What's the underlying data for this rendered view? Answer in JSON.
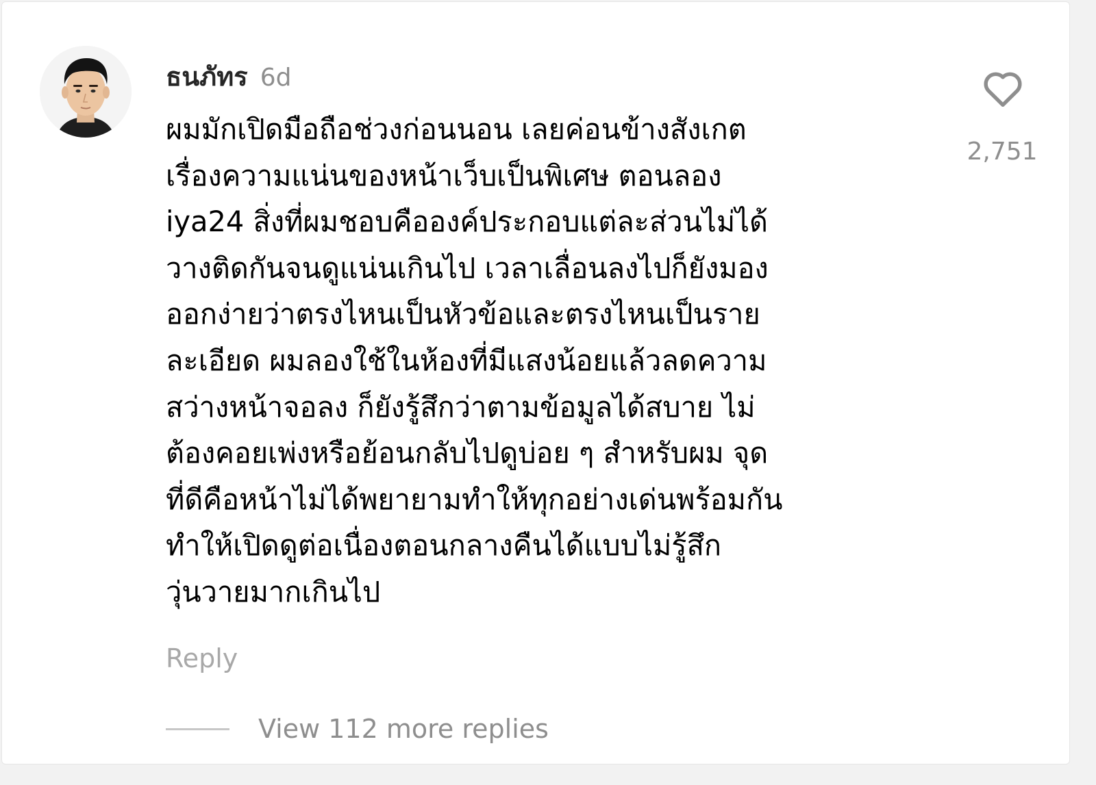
{
  "comment": {
    "username": "ธนภัทร",
    "time_ago": "6d",
    "text": "ผมมักเปิดมือถือช่วงก่อนนอน เลยค่อนข้างสังเกต\nเรื่องความแน่นของหน้าเว็บเป็นพิเศษ ตอนลอง\niya24 สิ่งที่ผมชอบคือองค์ประกอบแต่ละส่วนไม่ได้\nวางติดกันจนดูแน่นเกินไป เวลาเลื่อนลงไปก็ยังมอง\nออกง่ายว่าตรงไหนเป็นหัวข้อและตรงไหนเป็นราย\nละเอียด ผมลองใช้ในห้องที่มีแสงน้อยแล้วลดความ\nสว่างหน้าจอลง ก็ยังรู้สึกว่าตามข้อมูลได้สบาย ไม่\nต้องคอยเพ่งหรือย้อนกลับไปดูบ่อย ๆ สำหรับผม จุด\nที่ดีคือหน้าไม่ได้พยายามทำให้ทุกอย่างเด่นพร้อมกัน\nทำให้เปิดดูต่อเนื่องตอนกลางคืนได้แบบไม่รู้สึก\nวุ่นวายมากเกินไป",
    "like_count": "2,751",
    "like_icon": "heart-outline-icon",
    "reply_label": "Reply",
    "view_replies_label": "View 112 more replies"
  },
  "colors": {
    "primary_text": "#262626",
    "secondary_text": "#8e8e8e",
    "muted_text": "#a8a8a8",
    "background": "#ffffff"
  }
}
